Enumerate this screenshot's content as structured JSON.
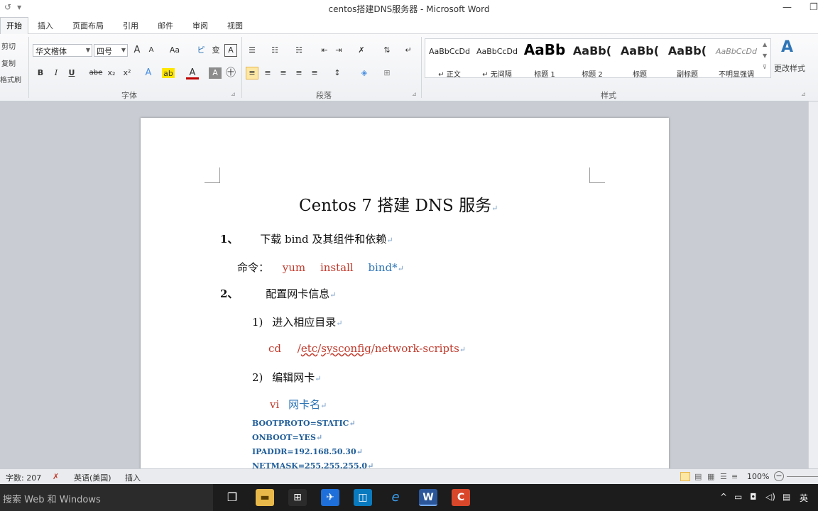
{
  "window": {
    "title": "centos搭建DNS服务器 - Microsoft Word",
    "minimize": "—",
    "restore": "❐"
  },
  "qat": {
    "undo": "↺",
    "customize": "▾"
  },
  "tabs": [
    {
      "label": "开始"
    },
    {
      "label": "插入"
    },
    {
      "label": "页面布局"
    },
    {
      "label": "引用"
    },
    {
      "label": "邮件"
    },
    {
      "label": "审阅"
    },
    {
      "label": "视图"
    }
  ],
  "ribbon": {
    "clipboard": {
      "cut": "剪切",
      "copy": "复制",
      "format_painter": "格式刷"
    },
    "font": {
      "group_label": "字体",
      "font_name": "华文楷体",
      "font_size": "四号",
      "grow": "A",
      "shrink": "A",
      "case": "Aa",
      "pinyin": "ピ",
      "phonetic": "变",
      "border": "A",
      "bold": "B",
      "italic": "I",
      "underline": "U",
      "strike": "abe",
      "subscript": "x₂",
      "superscript": "x²",
      "text_effect": "A",
      "highlight": "ab",
      "font_color": "A",
      "char_shading": "A",
      "enclose": "㊉"
    },
    "paragraph": {
      "group_label": "段落",
      "bullets": "☰",
      "numbering": "☷",
      "multilevel": "☵",
      "decrease_indent": "⇤",
      "increase_indent": "⇥",
      "chinese_layout": "✗",
      "sort": "⇅",
      "show_marks": "↵",
      "align_left": "≡",
      "center": "≡",
      "align_right": "≡",
      "justify": "≡",
      "distributed": "≡",
      "line_spacing": "↕",
      "shading": "◈",
      "borders": "⊞"
    },
    "styles": {
      "group_label": "样式",
      "items": [
        {
          "sample": "AaBbCcDd",
          "label": "↵ 正文"
        },
        {
          "sample": "AaBbCcDd",
          "label": "↵ 无间隔"
        },
        {
          "sample": "AaBb",
          "label": "标题 1"
        },
        {
          "sample": "AaBb(",
          "label": "标题 2"
        },
        {
          "sample": "AaBb(",
          "label": "标题"
        },
        {
          "sample": "AaBb(",
          "label": "副标题"
        },
        {
          "sample": "AaBbCcDd",
          "label": "不明显强调"
        }
      ],
      "change_styles": "更改样式"
    }
  },
  "document": {
    "title": "Centos 7  搭建 DNS 服务",
    "para_mark": "↵",
    "step1": {
      "num": "1、",
      "text": "下载 bind 及其组件和依赖"
    },
    "cmd1": {
      "label": "命令：",
      "w1": "yum",
      "w2": "install",
      "w3": "bind*"
    },
    "step2": {
      "num": "2、",
      "text": "配置网卡信息"
    },
    "sub1": {
      "num": "1)",
      "text": "进入相应目录"
    },
    "cd": {
      "cmd": "cd",
      "p1": "/",
      "p2": "etc",
      "p3": "/",
      "p4": "sysconfig",
      "p5": "/network-scripts"
    },
    "sub2": {
      "num": "2)",
      "text": "编辑网卡"
    },
    "vi": {
      "cmd": "vi",
      "text": "网卡名"
    },
    "config": [
      "BOOTPROTO=STATIC",
      "ONBOOT=YES",
      "IPADDR=192.168.50.30",
      "NETMASK=255.255.255.0"
    ]
  },
  "status": {
    "word_count": "字数: 207",
    "language": "英语(美国)",
    "mode": "插入",
    "zoom": "100%",
    "zoom_out": "−"
  },
  "taskbar": {
    "search_placeholder": "搜索 Web 和 Windows",
    "tray_chevron": "^",
    "lang": "英"
  }
}
